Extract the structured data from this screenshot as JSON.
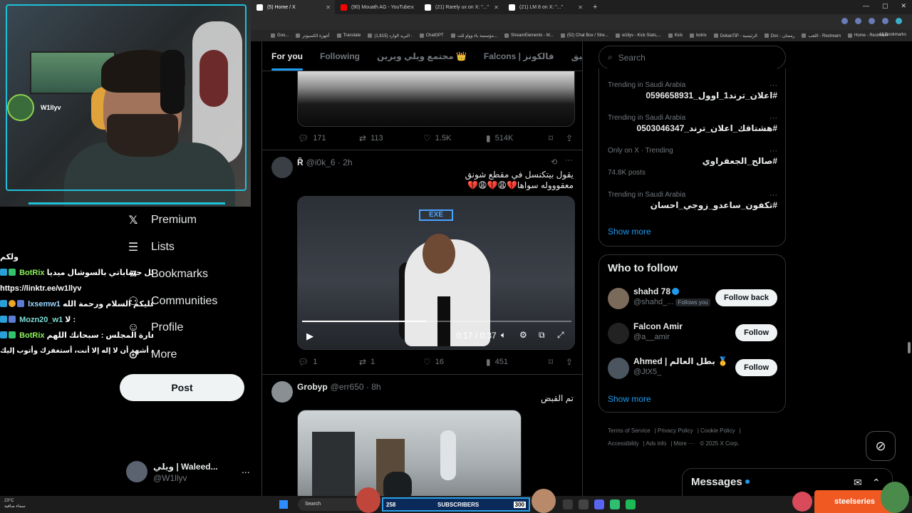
{
  "browser": {
    "tabs": [
      {
        "label": "(5) Home / X",
        "active": true,
        "favicon_color": "#ffffff"
      },
      {
        "label": "(90) Mouath AG - YouTube",
        "active": false,
        "favicon_color": "#ff0000"
      },
      {
        "label": "(21) Rarely ux on X: \"...\"",
        "active": false,
        "favicon_color": "#ffffff"
      },
      {
        "label": "(21) LM 8 on X: \"...\"",
        "active": false,
        "favicon_color": "#ffffff"
      }
    ],
    "new_tab": "+",
    "bookmarks": [
      "Goo...",
      "أجهزة الكمبيوتر",
      "Translate",
      "(1,815) البريد الوارد -",
      "ChatGPT",
      "مؤسسة باء وواو للت...",
      "StreamElements - M...",
      "(52) Chat Box / Stre...",
      "w1llyv - Kick Stats,...",
      "Kick",
      "botrix",
      "DokanTiP - الرئيسية",
      "Doc - رمضان",
      "اللعب - Restream",
      "Home - Restream"
    ],
    "all_bookmarks": "All Bookmarks"
  },
  "webcam": {
    "overlay_name": "W1llyv",
    "frame_color": "#1ec1d8"
  },
  "chat": {
    "lines": [
      {
        "user": "",
        "text": "ولكم"
      },
      {
        "user": "BotRix",
        "text": "حياكم بكل حساباتي بالسوشال ميديا :"
      },
      {
        "user": "",
        "text": "https://linktr.ee/w1llyv"
      },
      {
        "user": "lxsemw1",
        "text": "وعليكم السلام ورحمة الله :"
      },
      {
        "user": "Mozn20_w1",
        "text": "لا :"
      },
      {
        "user": "BotRix",
        "text": "كفارة المجلس : سبحانك اللهم"
      },
      {
        "user": "",
        "text": "وبحمدك، أشهد أن لا إله إلا أنت، أستغفرك وأتوب إليك"
      }
    ]
  },
  "nav": {
    "premium": "Premium",
    "lists": "Lists",
    "bookmarks": "Bookmarks",
    "communities": "Communities",
    "profile": "Profile",
    "more": "More",
    "post": "Post"
  },
  "account": {
    "name": "ويلي | Waleed...",
    "handle": "@W1llyv",
    "more": "..."
  },
  "feed": {
    "tabs": [
      "For you",
      "Following",
      "مجتمع ويلي ويرين 👑",
      "Falcons | فالكونز",
      "روكيت ليق | RL"
    ],
    "tweet1_actions": {
      "replies": "171",
      "reposts": "113",
      "likes": "1.5K",
      "views": "514K"
    },
    "tweet2": {
      "name": "R̃",
      "handle": "@i0k_6",
      "time": "2h",
      "text1": "يقول بيتكنسل في مقطع شونق",
      "text2": "معقوووله سواها💔😩💔😩💔",
      "video_sign": "EXE",
      "video_time": "0:17 / 0:37",
      "video_progress": 0.46,
      "actions": {
        "replies": "1",
        "reposts": "1",
        "likes": "16",
        "views": "451"
      }
    },
    "tweet3": {
      "name": "Grobyp",
      "handle": "@err650",
      "time": "8h",
      "text": "تم القبض"
    }
  },
  "sidebar": {
    "search_placeholder": "Search",
    "trends": [
      {
        "context": "Trending in Saudi Arabia",
        "title": "#اعلان_ترند1_اوول_0596658931",
        "posts": ""
      },
      {
        "context": "Trending in Saudi Arabia",
        "title": "#هشتاقك_اعلان_ترند_0503046347",
        "posts": ""
      },
      {
        "context": "Only on X · Trending",
        "title": "#صالح_الجعفراوي",
        "posts": "74.8K posts"
      },
      {
        "context": "Trending in Saudi Arabia",
        "title": "#تكفون_ساعدو_زوجي_احسان",
        "posts": ""
      }
    ],
    "trends_show_more": "Show more",
    "who_to_follow": "Who to follow",
    "follow": [
      {
        "name": "shahd 78",
        "handle": "@shahd_...",
        "follows_you": "Follows you",
        "button": "Follow back",
        "avatar_color": "#7a6a5a"
      },
      {
        "name": "Falcon Amir",
        "handle": "@a__amir",
        "follows_you": "",
        "button": "Follow",
        "avatar_color": "#222222"
      },
      {
        "name": "Ahmed | بطل العالم 🥇",
        "handle": "@JtX5_",
        "follows_you": "",
        "button": "Follow",
        "avatar_color": "#4a5560"
      }
    ],
    "follow_show_more": "Show more",
    "footer": [
      "Terms of Service",
      "Privacy Policy",
      "Cookie Policy",
      "Accessibility",
      "Ads info",
      "More ···",
      "© 2025 X Corp."
    ],
    "messages": "Messages"
  },
  "taskbar": {
    "weather_temp": "23°C",
    "weather_text": "سماء صافية",
    "search": "Search",
    "subscribers_left": "258",
    "subscribers_label": "SUBSCRIBERS",
    "subscribers_right": "300",
    "steelseries": "steelseries"
  },
  "colors": {
    "accent": "#1d9bf0",
    "background": "#000000",
    "border": "#2f3336",
    "steelseries": "#f05a22"
  }
}
